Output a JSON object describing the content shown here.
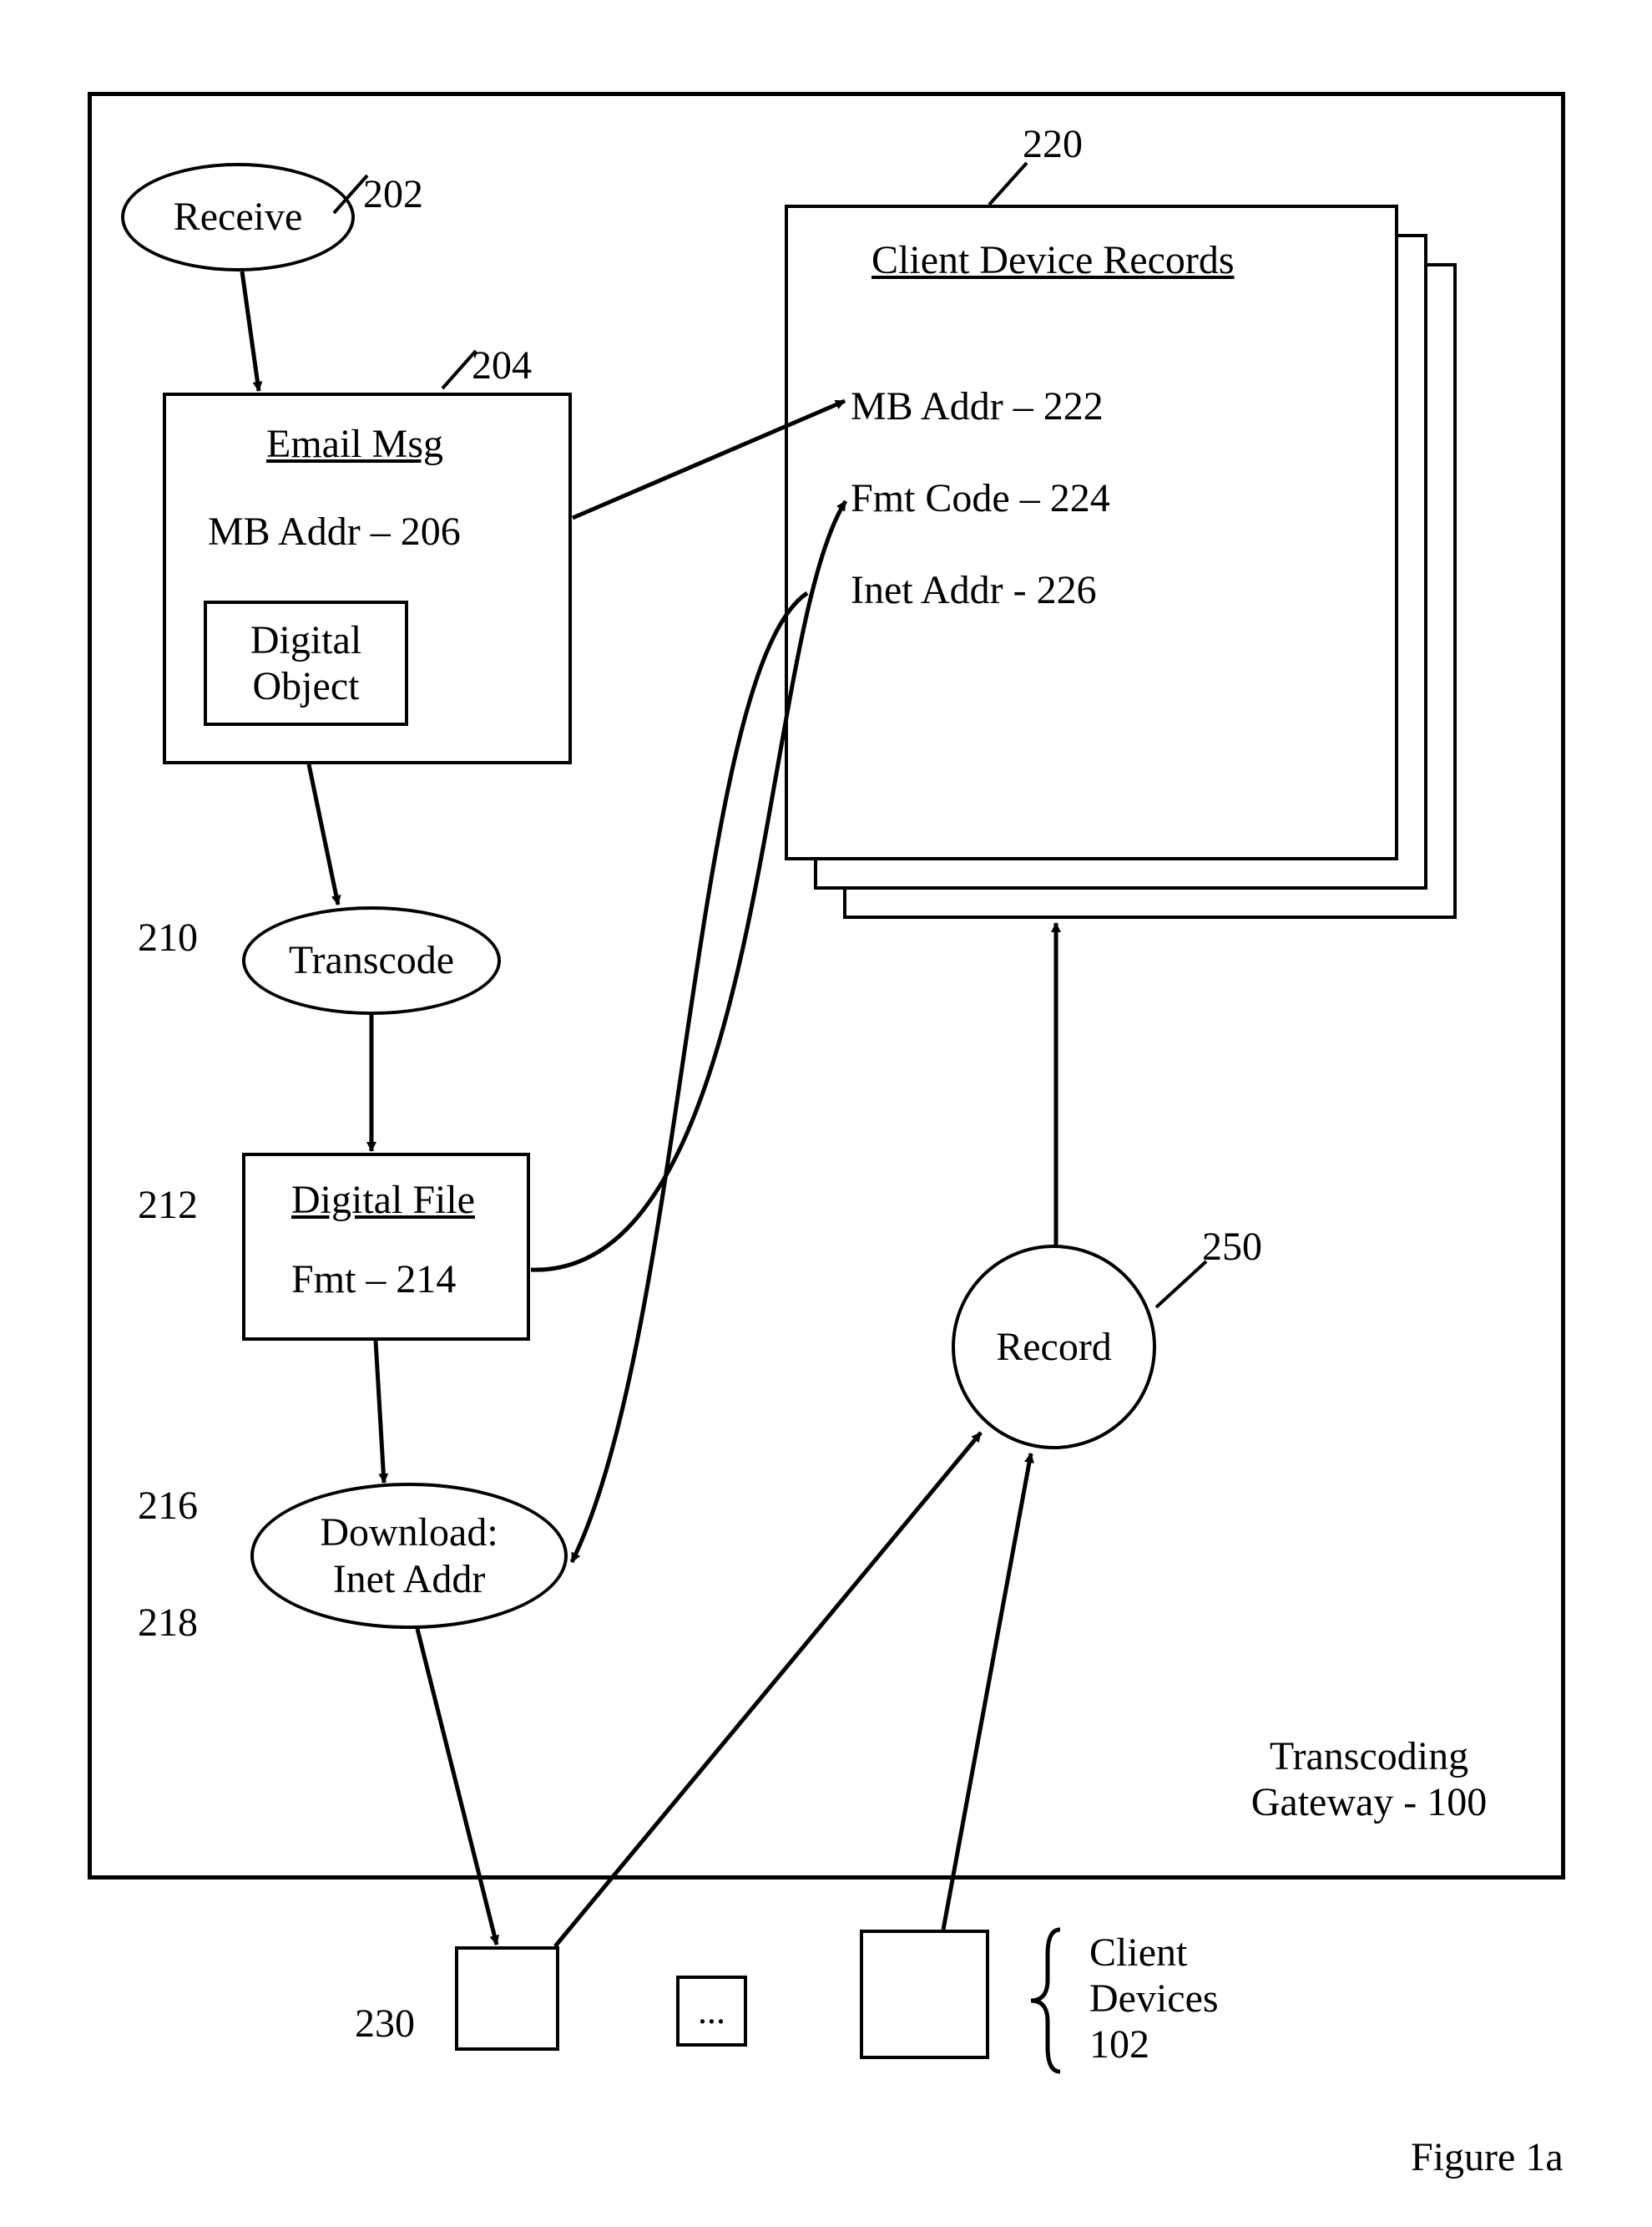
{
  "nodes": {
    "receive": {
      "label": "Receive",
      "ref": "202"
    },
    "email": {
      "title": "Email Msg",
      "ref": "204",
      "mb": "MB Addr – 206",
      "digital_object": "Digital\nObject"
    },
    "transcode": {
      "label": "Transcode",
      "ref": "210"
    },
    "digital_file": {
      "title": "Digital File",
      "ref": "212",
      "fmt": "Fmt – 214"
    },
    "download": {
      "line1": "Download:",
      "line2": "Inet Addr",
      "ref": "216",
      "ref2": "218"
    },
    "records": {
      "title": "Client Device Records",
      "ref": "220",
      "mb": "MB Addr – 222",
      "fmt": "Fmt Code – 224",
      "inet": "Inet Addr - 226"
    },
    "record_circle": {
      "label": "Record",
      "ref": "250"
    }
  },
  "clients": {
    "label": "Client\nDevices\n102",
    "dots": "...",
    "ref_230": "230"
  },
  "gateway_label": "Transcoding\nGateway - 100",
  "figure": "Figure 1a"
}
